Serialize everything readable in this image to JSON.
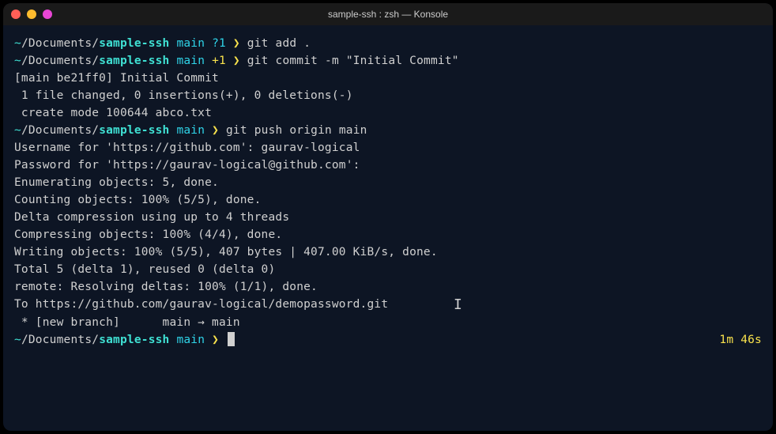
{
  "window": {
    "title": "sample-ssh : zsh — Konsole"
  },
  "prompt": {
    "tilde": "~",
    "slash1": "/",
    "docs": "Documents",
    "slash2": "/",
    "dir": "sample-ssh",
    "branch": "main",
    "status_untracked": "?1",
    "status_staged": "+1",
    "end": "❯"
  },
  "cmd1": "git add .",
  "cmd2": "git commit -m \"Initial Commit\"",
  "out_commit1": "[main be21ff0] Initial Commit",
  "out_commit2": " 1 file changed, 0 insertions(+), 0 deletions(-)",
  "out_commit3": " create mode 100644 abco.txt",
  "cmd3": "git push origin main",
  "out_push1": "Username for 'https://github.com': gaurav-logical",
  "out_push2": "Password for 'https://gaurav-logical@github.com':",
  "out_push3": "Enumerating objects: 5, done.",
  "out_push4": "Counting objects: 100% (5/5), done.",
  "out_push5": "Delta compression using up to 4 threads",
  "out_push6": "Compressing objects: 100% (4/4), done.",
  "out_push7": "Writing objects: 100% (5/5), 407 bytes | 407.00 KiB/s, done.",
  "out_push8": "Total 5 (delta 1), reused 0 (delta 0)",
  "out_push9": "remote: Resolving deltas: 100% (1/1), done.",
  "out_push10": "To https://github.com/gaurav-logical/demopassword.git",
  "out_push11": " * [new branch]      main → main",
  "elapsed": "1m 46s"
}
